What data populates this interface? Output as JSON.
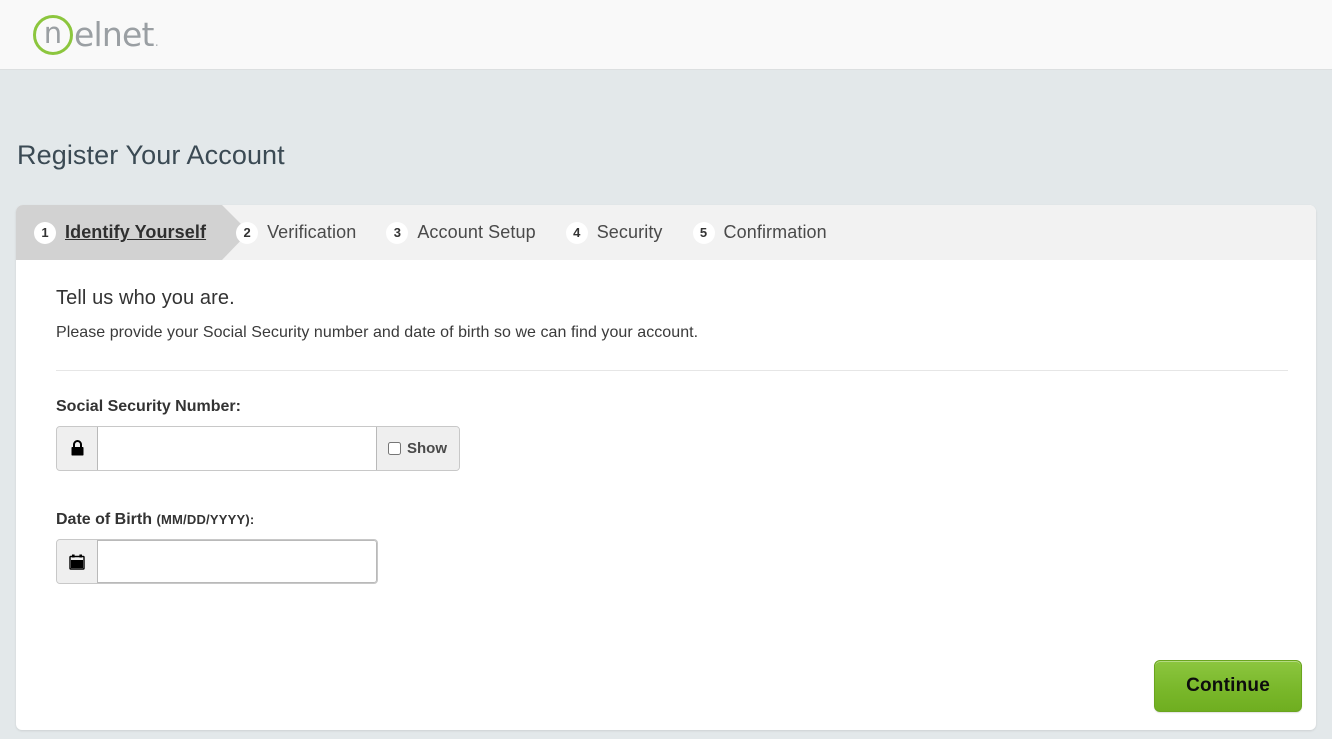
{
  "header": {
    "logo_mark_letter": "n",
    "logo_word": "elnet",
    "logo_dot": "."
  },
  "page": {
    "title": "Register Your Account"
  },
  "steps": [
    {
      "num": "1",
      "label": "Identify Yourself",
      "active": true
    },
    {
      "num": "2",
      "label": "Verification",
      "active": false
    },
    {
      "num": "3",
      "label": "Account Setup",
      "active": false
    },
    {
      "num": "4",
      "label": "Security",
      "active": false
    },
    {
      "num": "5",
      "label": "Confirmation",
      "active": false
    }
  ],
  "main": {
    "lead_title": "Tell us who you are.",
    "lead_desc": "Please provide your Social Security number and date of birth so we can find your account.",
    "ssn": {
      "label": "Social Security Number:",
      "value": "",
      "placeholder": "",
      "icon": "lock-icon",
      "show_label": "Show",
      "show_checked": false
    },
    "dob": {
      "label": "Date of Birth",
      "format_hint": "(MM/DD/YYYY):",
      "value": "",
      "placeholder": "",
      "icon": "calendar-icon"
    }
  },
  "footer": {
    "continue_label": "Continue"
  },
  "colors": {
    "brand_green": "#8cc63f",
    "page_background": "#e3e8ea",
    "card_background": "#ffffff",
    "stepbar_background": "#f2f2f2",
    "active_step_background": "#d2d2d2",
    "title_text": "#3b4a54"
  }
}
